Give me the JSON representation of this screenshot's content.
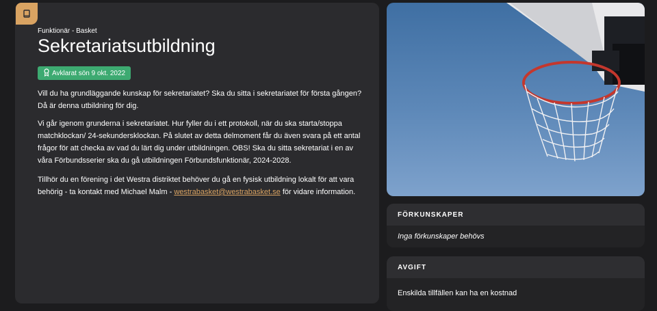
{
  "course": {
    "category": "Funktionär - Basket",
    "title": "Sekretariatsutbildning",
    "status": "Avklarat sön 9 okt. 2022",
    "paragraph1": "Vill du ha grundläggande kunskap för sekretariatet? Ska du sitta i sekretariatet för första gången? Då är denna utbildning för dig.",
    "paragraph2": "Vi går igenom grunderna i sekretariatet. Hur fyller du i ett protokoll, när du ska starta/stoppa matchklockan/ 24-sekundersklockan. På slutet av detta delmoment får du även svara på ett antal frågor för att checka av vad du lärt dig under utbildningen. OBS! Ska du sitta sekretariat i en av våra Förbundsserier ska du gå utbildningen Förbundsfunktionär, 2024-2028.",
    "paragraph3_before": "Tillhör du en förening i det Westra distriktet behöver du gå en fysisk utbildning lokalt för att vara behörig - ta kontakt med Michael Malm - ",
    "contact_email": "westrabasket@westrabasket.se",
    "paragraph3_after": " för vidare information."
  },
  "prerequisites": {
    "header": "FÖRKUNSKAPER",
    "text": "Inga förkunskaper behövs"
  },
  "fee": {
    "header": "AVGIFT",
    "text": "Enskilda tillfällen kan ha en kostnad"
  },
  "icons": {
    "course": "book-icon",
    "status": "award-icon"
  },
  "colors": {
    "accent": "#d9a362",
    "success": "#3daa71"
  }
}
